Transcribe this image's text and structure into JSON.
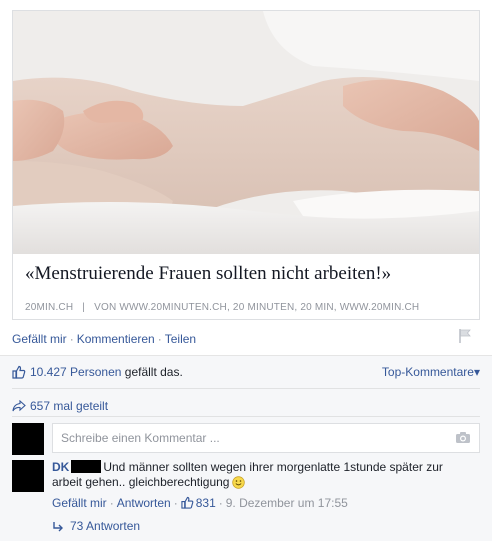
{
  "link_preview": {
    "headline": "«Menstruierende Frauen sollten nicht arbeiten!»",
    "source_site": "20MIN.CH",
    "source_separator": "|",
    "source_byline": "VON WWW.20MINUTEN.CH, 20 MINUTEN, 20 MIN, WWW.20MIN.CH"
  },
  "actions": {
    "like": "Gefällt mir",
    "comment": "Kommentieren",
    "share": "Teilen",
    "separator": "·"
  },
  "feedback": {
    "likes_count": "10.427",
    "likes_people": "Personen",
    "likes_suffix": "gefällt das.",
    "top_comments": "Top-Kommentare",
    "top_comments_caret": "▾",
    "shares": "657 mal geteilt"
  },
  "composer": {
    "placeholder": "Schreibe einen Kommentar ..."
  },
  "comment": {
    "author": "DK",
    "text_line": "Und männer sollten wegen ihrer morgenlatte 1stunde später zur arbeit gehen.. gleichberechtigung",
    "like": "Gefällt mir",
    "reply": "Antworten",
    "like_count": "831",
    "timestamp": "9. Dezember um 17:55",
    "separator": "·",
    "replies": "73 Antworten"
  },
  "colors": {
    "link_blue": "#365899",
    "muted_gray": "#90949c",
    "feedback_bg": "#f6f7f9"
  },
  "icons": [
    "flag-icon",
    "thumbs-up-icon",
    "share-arrow-icon",
    "camera-icon",
    "smiley-icon",
    "reply-arrow-icon"
  ]
}
